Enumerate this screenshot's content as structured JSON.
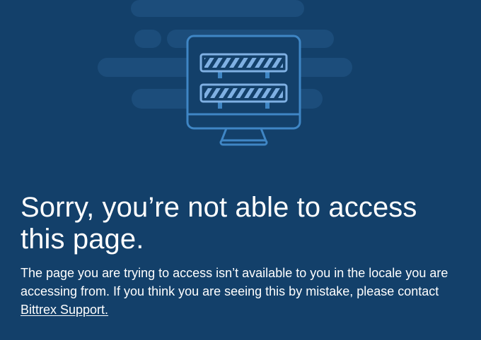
{
  "colors": {
    "background": "#13406a",
    "cloud": "#1c4d7b",
    "monitor_stroke": "#3f86c5",
    "stripe": "#7fb0e3",
    "text": "#ffffff"
  },
  "illustration": {
    "icon": "blocked-monitor-icon"
  },
  "error": {
    "headline": "Sorry, you’re not able to access this page.",
    "message": "The page you are trying to access isn’t available to you in the locale you are accessing from. If you think you are seeing this by mistake, please contact",
    "support_link_label": "Bittrex Support."
  }
}
